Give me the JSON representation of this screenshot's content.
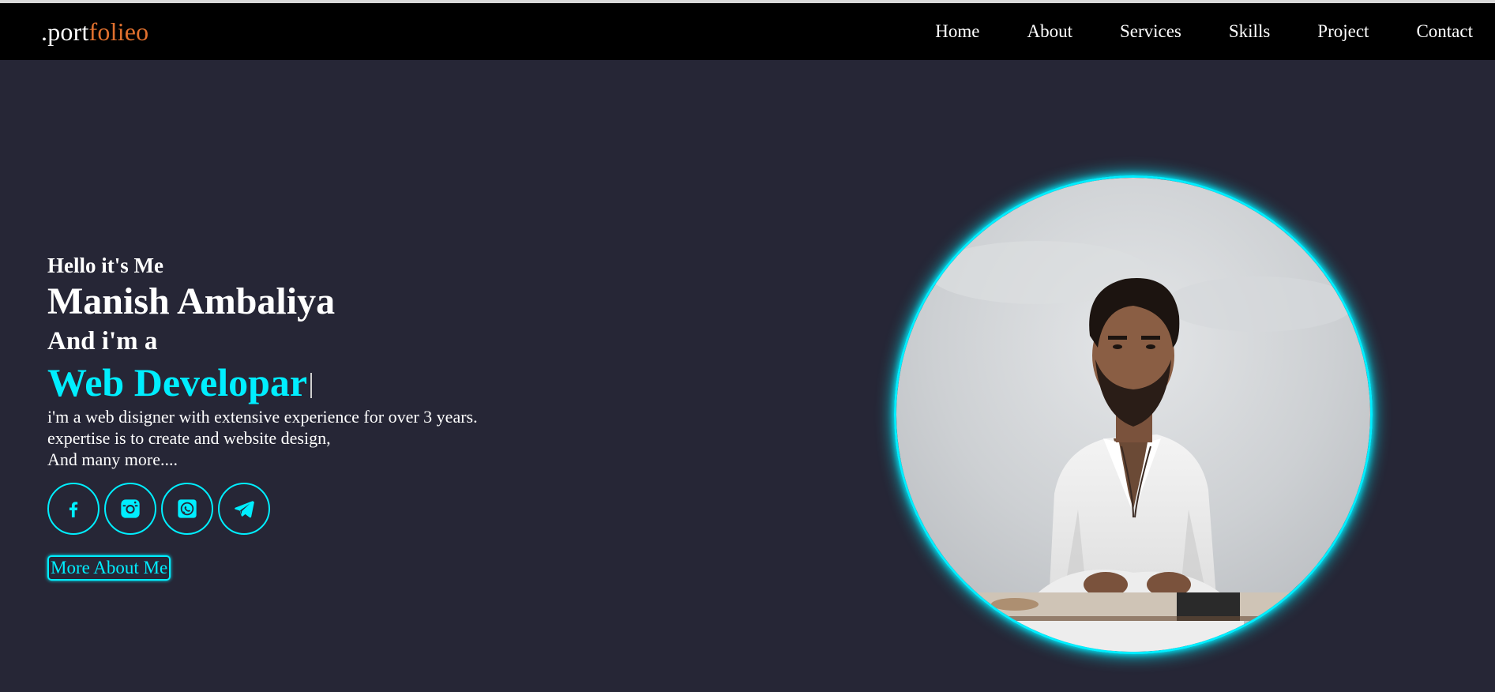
{
  "logo": {
    "part1": ".port",
    "part2": "folieo",
    "accent_color": "#e0702e"
  },
  "nav": {
    "items": [
      "Home",
      "About",
      "Services",
      "Skills",
      "Project",
      "Contact"
    ]
  },
  "hero": {
    "greeting": "Hello it's Me",
    "name": "Manish Ambaliya",
    "intro": "And i'm a",
    "role": "Web Developar",
    "description": [
      "i'm a web disigner with extensive experience for over 3 years.",
      "expertise is to create and website design,",
      "And many more...."
    ],
    "socials": [
      "facebook-icon",
      "instagram-icon",
      "whatsapp-icon",
      "telegram-icon"
    ],
    "button_label": "More About Me"
  },
  "colors": {
    "accent": "#00eeff",
    "background": "#262636",
    "header": "#000000"
  }
}
